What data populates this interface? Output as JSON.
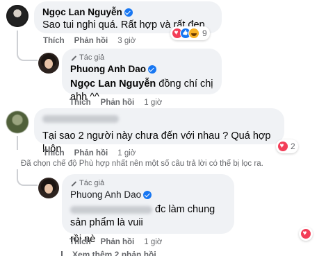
{
  "comments": [
    {
      "author": "Ngọc Lan Nguyễn",
      "text": "Sao tui nghi quá. Rất hợp và rất đẹp",
      "actions": {
        "like": "Thích",
        "reply": "Phản hồi",
        "time": "3 giờ"
      },
      "reactions": {
        "icons": [
          "love-icon",
          "like-icon",
          "haha-icon"
        ],
        "count": "9"
      }
    },
    {
      "author_tag": "Tác giả",
      "author": "Phuong Anh Dao",
      "tagged_name": "Ngọc Lan Nguyễn",
      "text": " đồng chí chị ahh ^^",
      "actions": {
        "like": "Thích",
        "reply": "Phản hồi",
        "time": "1 giờ"
      }
    },
    {
      "author": "",
      "text": "Tại sao 2 người này chưa đến với nhau ? Quá hợp luôn",
      "actions": {
        "like": "Thích",
        "reply": "Phản hồi",
        "time": "1 giờ"
      },
      "reactions": {
        "icons": [
          "love-icon"
        ],
        "count": "2"
      }
    },
    {
      "author_tag": "Tác giả",
      "author": "Phuong Anh Dao",
      "text_line1": "đc làm chung sản phẩm là vuii",
      "text_line2": "rồi nè",
      "actions": {
        "like": "Thích",
        "reply": "Phản hồi",
        "time": "1 giờ"
      },
      "reactions": {
        "icons": [
          "love-icon"
        ]
      }
    }
  ],
  "filter_note": "Đã chọn chế độ Phù hợp nhất nên một số câu trả lời có thể bị lọc ra.",
  "more_replies": "Xem thêm 2 phản hồi",
  "colors": {
    "bubble": "#f0f2f5",
    "verified": "#1877f2",
    "meta": "#65676b",
    "love": "#f33e58"
  }
}
